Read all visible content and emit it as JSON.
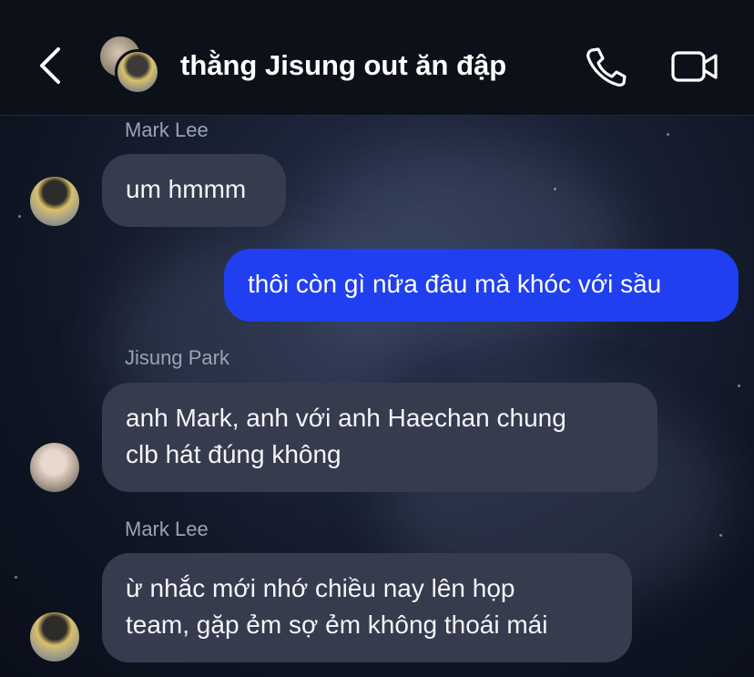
{
  "header": {
    "title": "thằng Jisung out ăn đập"
  },
  "messages": [
    {
      "sender": "Mark Lee",
      "text": "um hmmm",
      "from_me": false
    },
    {
      "sender": "",
      "text": "thôi còn gì nữa đâu mà khóc với sầu",
      "from_me": true
    },
    {
      "sender": "Jisung Park",
      "lines": [
        "anh Mark, anh với anh Haechan chung",
        "clb hát đúng không"
      ],
      "from_me": false
    },
    {
      "sender": "Mark Lee",
      "lines": [
        "ừ nhắc mới nhớ chiều nay lên họp",
        "team, gặp ẻm sợ ẻm không thoái mái"
      ],
      "from_me": false
    }
  ],
  "colors": {
    "outgoing_bubble": "#1f3ff0",
    "incoming_bubble": "#363b4e",
    "header_bg": "#0b1019",
    "sender_name": "#9aa3b3"
  },
  "icons": {
    "back": "chevron-left-icon",
    "call": "phone-icon",
    "video": "video-camera-icon"
  }
}
